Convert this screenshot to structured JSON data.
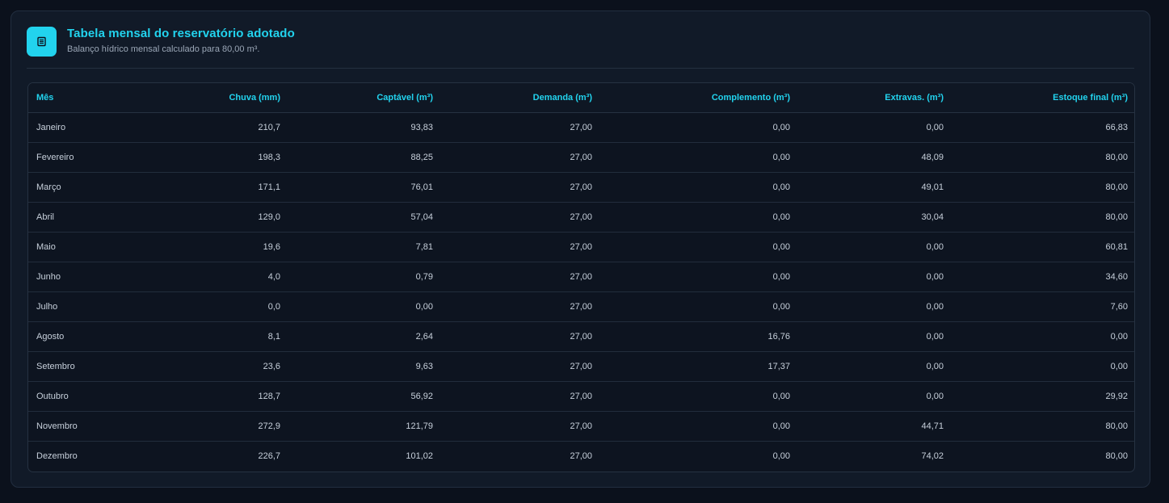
{
  "header": {
    "icon": "table-list-icon",
    "title": "Tabela mensal do reservatório adotado",
    "subtitle": "Balanço hídrico mensal calculado para 80,00 m³."
  },
  "table": {
    "columns": [
      "Mês",
      "Chuva (mm)",
      "Captável (m³)",
      "Demanda (m³)",
      "Complemento (m³)",
      "Extravas. (m³)",
      "Estoque final (m³)"
    ],
    "rows": [
      [
        "Janeiro",
        "210,7",
        "93,83",
        "27,00",
        "0,00",
        "0,00",
        "66,83"
      ],
      [
        "Fevereiro",
        "198,3",
        "88,25",
        "27,00",
        "0,00",
        "48,09",
        "80,00"
      ],
      [
        "Março",
        "171,1",
        "76,01",
        "27,00",
        "0,00",
        "49,01",
        "80,00"
      ],
      [
        "Abril",
        "129,0",
        "57,04",
        "27,00",
        "0,00",
        "30,04",
        "80,00"
      ],
      [
        "Maio",
        "19,6",
        "7,81",
        "27,00",
        "0,00",
        "0,00",
        "60,81"
      ],
      [
        "Junho",
        "4,0",
        "0,79",
        "27,00",
        "0,00",
        "0,00",
        "34,60"
      ],
      [
        "Julho",
        "0,0",
        "0,00",
        "27,00",
        "0,00",
        "0,00",
        "7,60"
      ],
      [
        "Agosto",
        "8,1",
        "2,64",
        "27,00",
        "16,76",
        "0,00",
        "0,00"
      ],
      [
        "Setembro",
        "23,6",
        "9,63",
        "27,00",
        "17,37",
        "0,00",
        "0,00"
      ],
      [
        "Outubro",
        "128,7",
        "56,92",
        "27,00",
        "0,00",
        "0,00",
        "29,92"
      ],
      [
        "Novembro",
        "272,9",
        "121,79",
        "27,00",
        "0,00",
        "44,71",
        "80,00"
      ],
      [
        "Dezembro",
        "226,7",
        "101,02",
        "27,00",
        "0,00",
        "74,02",
        "80,00"
      ]
    ]
  },
  "colors": {
    "accent": "#22d3ee",
    "background": "#0b111c",
    "card": "#111a28"
  }
}
